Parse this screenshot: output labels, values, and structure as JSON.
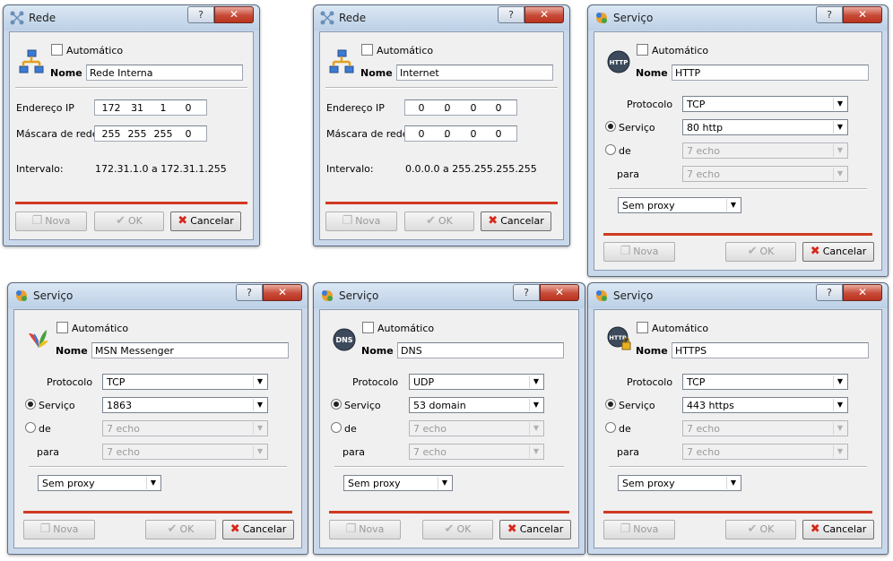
{
  "labels": {
    "automatico": "Automático",
    "nome": "Nome",
    "endereco_ip": "Endereço IP",
    "mascara": "Máscara de rede",
    "intervalo": "Intervalo:",
    "protocolo": "Protocolo",
    "servico": "Serviço",
    "de": "de",
    "para": "para",
    "nova": "Nova",
    "ok": "OK",
    "cancelar": "Cancelar",
    "help_glyph": "?",
    "close_glyph": "✕"
  },
  "rede_interna": {
    "title": "Rede",
    "name": "Rede Interna",
    "ip": [
      "172",
      "31",
      "1",
      "0"
    ],
    "mask": [
      "255",
      "255",
      "255",
      "0"
    ],
    "range": "172.31.1.0 a 172.31.1.255"
  },
  "rede_internet": {
    "title": "Rede",
    "name": "Internet",
    "ip": [
      "0",
      "0",
      "0",
      "0"
    ],
    "mask": [
      "0",
      "0",
      "0",
      "0"
    ],
    "range": "0.0.0.0 a 255.255.255.255"
  },
  "svc_http": {
    "title": "Serviço",
    "name": "HTTP",
    "protocol": "TCP",
    "service": "80 http",
    "de": "7 echo",
    "para": "7 echo",
    "proxy": "Sem proxy",
    "icon_text": "HTTP"
  },
  "svc_msn": {
    "title": "Serviço",
    "name": "MSN Messenger",
    "protocol": "TCP",
    "service": "1863",
    "de": "7 echo",
    "para": "7 echo",
    "proxy": "Sem proxy"
  },
  "svc_dns": {
    "title": "Serviço",
    "name": "DNS",
    "protocol": "UDP",
    "service": "53 domain",
    "de": "7 echo",
    "para": "7 echo",
    "proxy": "Sem proxy",
    "icon_text": "DNS"
  },
  "svc_https": {
    "title": "Serviço",
    "name": "HTTPS",
    "protocol": "TCP",
    "service": "443 https",
    "de": "7 echo",
    "para": "7 echo",
    "proxy": "Sem proxy",
    "icon_text": "HTTP"
  },
  "colors": {
    "frame": "#c9d8ea",
    "close_button": "#c74a38",
    "red_line": "#d03a22",
    "client": "#f0f0f0"
  }
}
